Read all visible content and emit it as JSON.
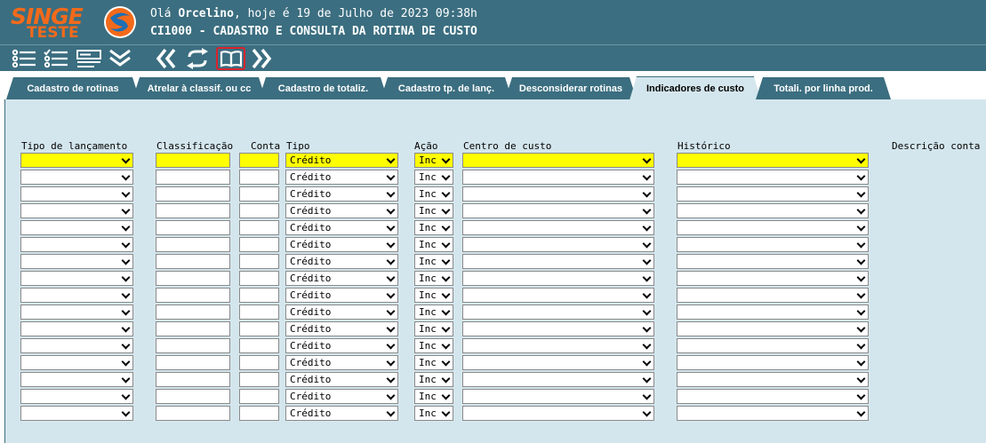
{
  "header": {
    "logo_top": "SINGE",
    "logo_bottom": "TESTE",
    "greeting_prefix": "Olá ",
    "user_name": "Orcelino",
    "greeting_suffix": ", hoje é 19 de Julho de 2023 09:38h",
    "routine_title": "CI1000 - CADASTRO E CONSULTA DA ROTINA DE CUSTO"
  },
  "toolbar": {
    "icons": [
      "list-icon",
      "checklist-icon",
      "form-icon",
      "expand-down-icon",
      "previous-icon",
      "refresh-icon",
      "book-icon",
      "next-icon"
    ]
  },
  "tabs": [
    {
      "label": "Cadastro de rotinas",
      "active": false
    },
    {
      "label": "Atrelar à classif. ou cc",
      "active": false
    },
    {
      "label": "Cadastro de totaliz.",
      "active": false
    },
    {
      "label": "Cadastro tp. de lanç.",
      "active": false
    },
    {
      "label": "Desconsiderar rotinas",
      "active": false
    },
    {
      "label": "Indicadores de custo",
      "active": true
    },
    {
      "label": "Totali. por linha prod.",
      "active": false
    }
  ],
  "columns": {
    "tipo_lancamento": "Tipo de lançamento",
    "classificacao": "Classificação",
    "conta": "Conta",
    "tipo": "Tipo",
    "acao": "Ação",
    "centro_custo": "Centro de custo",
    "historico": "Histórico",
    "descricao_conta": "Descrição conta"
  },
  "rows": {
    "count": 16,
    "tipo_value": "Crédito",
    "acao_value": "Inc",
    "first_row_highlight": "#ffff00"
  },
  "colors": {
    "header_bg": "#3b6e80",
    "content_bg": "#d4e6ed",
    "logo_orange": "#f26a1b",
    "highlight_red": "#d9232d"
  }
}
